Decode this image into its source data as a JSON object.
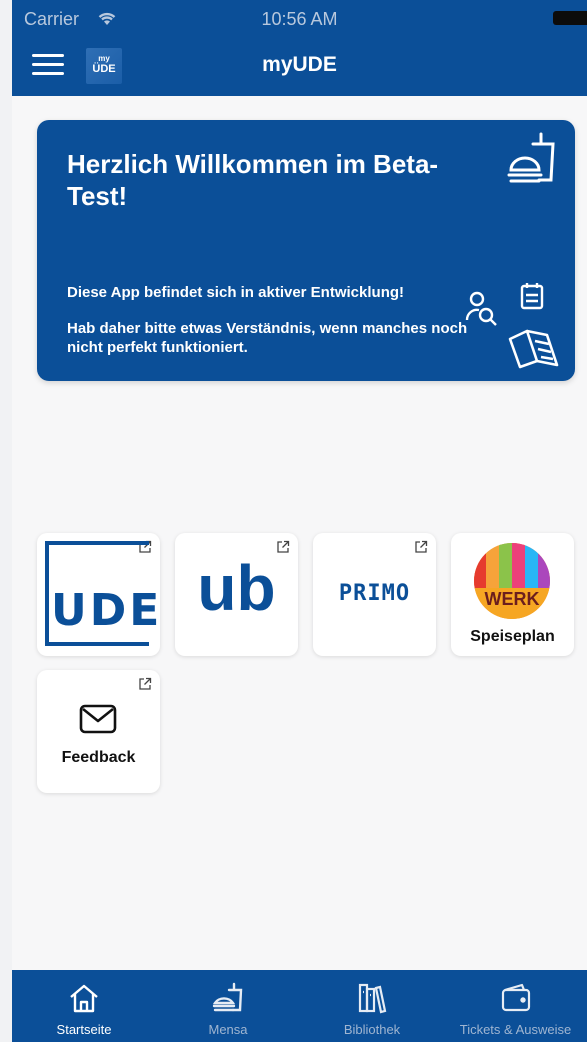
{
  "status_bar": {
    "carrier": "Carrier",
    "time": "10:56 AM"
  },
  "navbar": {
    "title": "myUDE",
    "logo_top": "my",
    "logo_bottom": "ÜDE"
  },
  "hero": {
    "title": "Herzlich Willkommen im Beta-Test!",
    "line1": "Diese App befindet sich in aktiver Entwicklung!",
    "line2": "Hab daher bitte etwas Verständnis, wenn manches noch nicht perfekt funktioniert."
  },
  "tiles": {
    "ude_logo_text": "UDE",
    "ub_logo_text": "ub",
    "primo_logo_text": "PRIMO",
    "werk_logo_text": "WERK",
    "speiseplan_label": "Speiseplan",
    "feedback_label": "Feedback"
  },
  "tabbar": {
    "items": [
      {
        "label": "Startseite",
        "active": true
      },
      {
        "label": "Mensa",
        "active": false
      },
      {
        "label": "Bibliothek",
        "active": false
      },
      {
        "label": "Tickets & Ausweise",
        "active": false
      }
    ]
  },
  "colors": {
    "brand_blue": "#0b4f98",
    "background": "#f7f7f8",
    "tab_inactive": "#9fb5d1"
  },
  "icons": [
    "hamburger-icon",
    "wifi-icon",
    "battery-icon",
    "meal-tray-icon",
    "person-search-icon",
    "calendar-icon",
    "book-icon",
    "external-link-icon",
    "mail-icon",
    "home-icon",
    "burger-icon",
    "library-icon",
    "wallet-icon"
  ]
}
